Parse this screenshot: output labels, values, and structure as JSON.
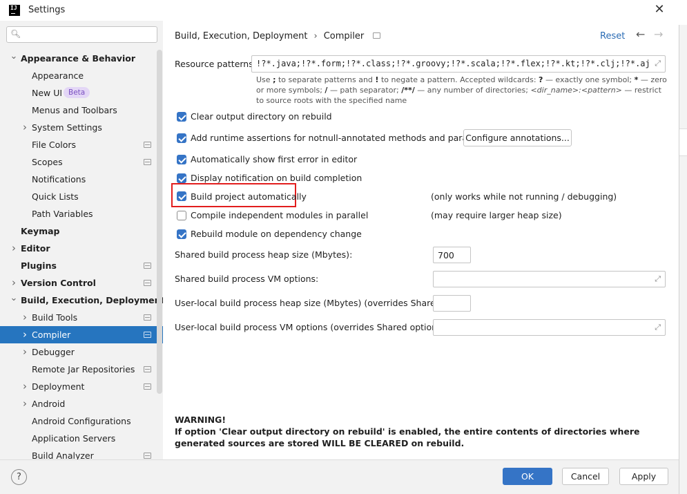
{
  "window": {
    "title": "Settings",
    "logo_text": "IJ"
  },
  "search": {
    "placeholder": ""
  },
  "sidebar": {
    "items": [
      {
        "label": "Appearance & Behavior",
        "bold": true,
        "arrow": "down",
        "level": 0
      },
      {
        "label": "Appearance",
        "level": 1
      },
      {
        "label": "New UI",
        "level": 1,
        "badge": "Beta"
      },
      {
        "label": "Menus and Toolbars",
        "level": 1
      },
      {
        "label": "System Settings",
        "level": 1,
        "arrow": "right"
      },
      {
        "label": "File Colors",
        "level": 1,
        "project": true
      },
      {
        "label": "Scopes",
        "level": 1,
        "project": true
      },
      {
        "label": "Notifications",
        "level": 1
      },
      {
        "label": "Quick Lists",
        "level": 1
      },
      {
        "label": "Path Variables",
        "level": 1
      },
      {
        "label": "Keymap",
        "bold": true,
        "level": 0
      },
      {
        "label": "Editor",
        "bold": true,
        "arrow": "right",
        "level": 0
      },
      {
        "label": "Plugins",
        "bold": true,
        "level": 0,
        "project": true
      },
      {
        "label": "Version Control",
        "bold": true,
        "arrow": "right",
        "level": 0,
        "project": true
      },
      {
        "label": "Build, Execution, Deployment",
        "bold": true,
        "arrow": "down",
        "level": 0
      },
      {
        "label": "Build Tools",
        "level": 1,
        "arrow": "right",
        "project": true
      },
      {
        "label": "Compiler",
        "level": 1,
        "arrow": "right",
        "project": true,
        "selected": true
      },
      {
        "label": "Debugger",
        "level": 1,
        "arrow": "right"
      },
      {
        "label": "Remote Jar Repositories",
        "level": 1,
        "project": true
      },
      {
        "label": "Deployment",
        "level": 1,
        "arrow": "right",
        "project": true
      },
      {
        "label": "Android",
        "level": 1,
        "arrow": "right"
      },
      {
        "label": "Android Configurations",
        "level": 1
      },
      {
        "label": "Application Servers",
        "level": 1
      },
      {
        "label": "Build Analyzer",
        "level": 1,
        "project": true
      }
    ]
  },
  "header": {
    "breadcrumb_parent": "Build, Execution, Deployment",
    "breadcrumb_sep": "›",
    "breadcrumb_current": "Compiler",
    "reset": "Reset"
  },
  "resource": {
    "label": "Resource patterns:",
    "value": "!?*.java;!?*.form;!?*.class;!?*.groovy;!?*.scala;!?*.flex;!?*.kt;!?*.clj;!?*.aj",
    "hint_1": "Use",
    "hint_2": ";",
    "hint_3": "to separate patterns and",
    "hint_4": "!",
    "hint_5": "to negate a pattern. Accepted wildcards:",
    "hint_6": "?",
    "hint_7": "— exactly one symbol;",
    "hint_8": "*",
    "hint_9": "— zero or more symbols;",
    "hint_10": "/",
    "hint_11": "— path separator;",
    "hint_12": "/**/",
    "hint_13": "— any number of directories;",
    "hint_14": "<dir_name>:<pattern>",
    "hint_15": "— restrict to source roots with the specified name"
  },
  "options": {
    "clear_output": "Clear output directory on rebuild",
    "runtime_assertions": "Add runtime assertions for notnull-annotated methods and parameters",
    "configure_annotations": "Configure annotations...",
    "show_first_error": "Automatically show first error in editor",
    "display_notification": "Display notification on build completion",
    "build_auto": "Build project automatically",
    "build_auto_note": "(only works while not running / debugging)",
    "compile_parallel": "Compile independent modules in parallel",
    "compile_parallel_note": "(may require larger heap size)",
    "rebuild_module": "Rebuild module on dependency change"
  },
  "checkbox_states": {
    "clear_output": true,
    "runtime_assertions": true,
    "show_first_error": true,
    "display_notification": true,
    "build_auto": true,
    "compile_parallel": false,
    "rebuild_module": true
  },
  "fields": {
    "heap_label": "Shared build process heap size (Mbytes):",
    "heap_value": "700",
    "vm_label": "Shared build process VM options:",
    "vm_value": "",
    "local_heap_label": "User-local build process heap size (Mbytes) (overrides Shared size):",
    "local_heap_value": "",
    "local_vm_label": "User-local build process VM options (overrides Shared options):",
    "local_vm_value": ""
  },
  "warning": {
    "title": "WARNING!",
    "text": "If option 'Clear output directory on rebuild' is enabled, the entire contents of directories where generated sources are stored WILL BE CLEARED on rebuild."
  },
  "footer": {
    "help": "?",
    "ok": "OK",
    "cancel": "Cancel",
    "apply": "Apply"
  },
  "colors": {
    "accent": "#3574c6",
    "selection": "#2675bf",
    "highlight": "#e21d1d",
    "link": "#2a6bb4"
  }
}
